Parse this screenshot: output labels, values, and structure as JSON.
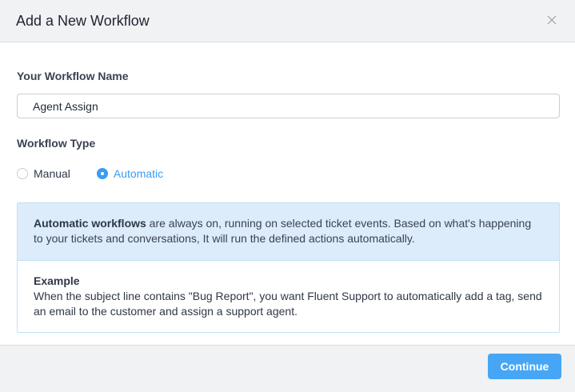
{
  "modal": {
    "title": "Add a New Workflow"
  },
  "form": {
    "name_label": "Your Workflow Name",
    "name_value": "Agent Assign",
    "type_label": "Workflow Type",
    "types": [
      {
        "label": "Manual",
        "checked": false
      },
      {
        "label": "Automatic",
        "checked": true
      }
    ]
  },
  "info": {
    "bold_lead": "Automatic workflows",
    "description": " are always on, running on selected ticket events. Based on what's happening to your tickets and conversations, It will run the defined actions automatically.",
    "example_title": "Example",
    "example_text": "When the subject line contains \"Bug Report\", you want Fluent Support to automatically add a tag, send an email to the customer and assign a support agent."
  },
  "footer": {
    "continue_label": "Continue"
  },
  "colors": {
    "accent": "#3b9cf2",
    "info_bg": "#dcecfa",
    "header_bg": "#f1f2f4"
  },
  "icons": {
    "close": "close-icon"
  }
}
